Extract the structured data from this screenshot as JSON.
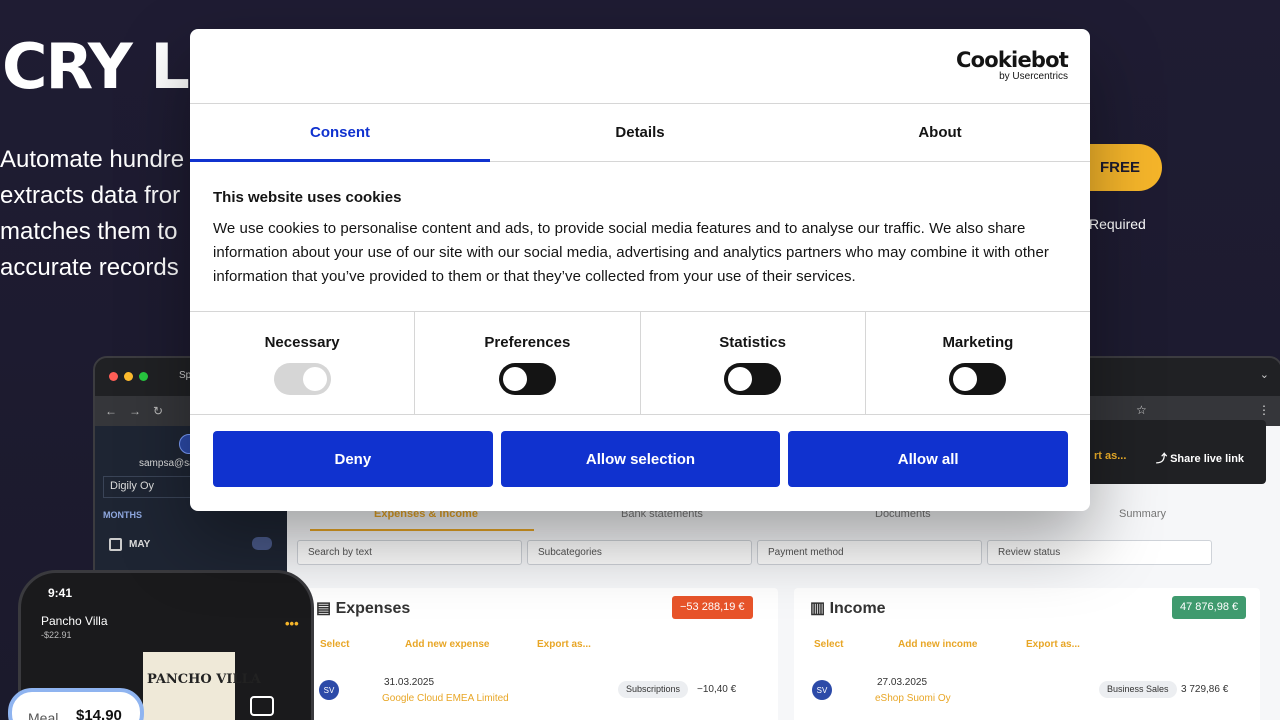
{
  "background": {
    "hero_title": "CRY LI",
    "hero_lines": [
      "Automate hundre",
      "extracts data fror",
      "matches them to",
      "accurate records"
    ],
    "cta_label": "FREE",
    "cta_note": "Required",
    "laptop": {
      "browser_tab": "Sp",
      "side_user_email": "sampsa@sa",
      "side_company": "Digily Oy",
      "months_heading": "MONTHS",
      "month_may": "MAY",
      "toolbar_export": "rt as...",
      "toolbar_share": "Share live link",
      "tabs": [
        "Expenses & Income",
        "Bank statements",
        "Documents",
        "Summary"
      ],
      "filters": [
        "Search by text",
        "Subcategories",
        "Payment method",
        "Review status"
      ],
      "expenses": {
        "title": "Expenses",
        "amount": "−53 288,19 €",
        "actions": [
          "Select",
          "Add new expense",
          "Export as..."
        ],
        "row": {
          "avatar": "SV",
          "date": "31.03.2025",
          "name": "Google Cloud EMEA Limited",
          "tag": "Subscriptions",
          "value": "−10,40 €"
        }
      },
      "income": {
        "title": "Income",
        "amount": "47 876,98 €",
        "actions": [
          "Select",
          "Add new income",
          "Export as..."
        ],
        "row": {
          "avatar": "SV",
          "date": "27.03.2025",
          "name": "eShop Suomi Oy",
          "tag": "Business Sales",
          "value": "3 729,86 €"
        }
      }
    },
    "phone": {
      "time": "9:41",
      "merchant": "Pancho Villa",
      "merchant_amount": "-$22.91",
      "receipt_title": "PANCHO VILLA",
      "meal_label": "Meal",
      "meal_value": "$14.90"
    }
  },
  "cookie_dialog": {
    "logo": {
      "main": "Cookiebot",
      "sub": "by Usercentrics"
    },
    "tabs": [
      {
        "label": "Consent",
        "active": true
      },
      {
        "label": "Details",
        "active": false
      },
      {
        "label": "About",
        "active": false
      }
    ],
    "heading": "This website uses cookies",
    "body_text": "We use cookies to personalise content and ads, to provide social media features and to analyse our traffic. We also share information about your use of our site with our social media, advertising and analytics partners who may combine it with other information that you’ve provided to them or that they’ve collected from your use of their services.",
    "toggles": [
      {
        "label": "Necessary",
        "state": "on",
        "disabled": true
      },
      {
        "label": "Preferences",
        "state": "off",
        "disabled": false
      },
      {
        "label": "Statistics",
        "state": "off",
        "disabled": false
      },
      {
        "label": "Marketing",
        "state": "off",
        "disabled": false
      }
    ],
    "buttons": {
      "deny": "Deny",
      "allow_selection": "Allow selection",
      "allow_all": "Allow all"
    },
    "accent_color": "#1032cf"
  }
}
